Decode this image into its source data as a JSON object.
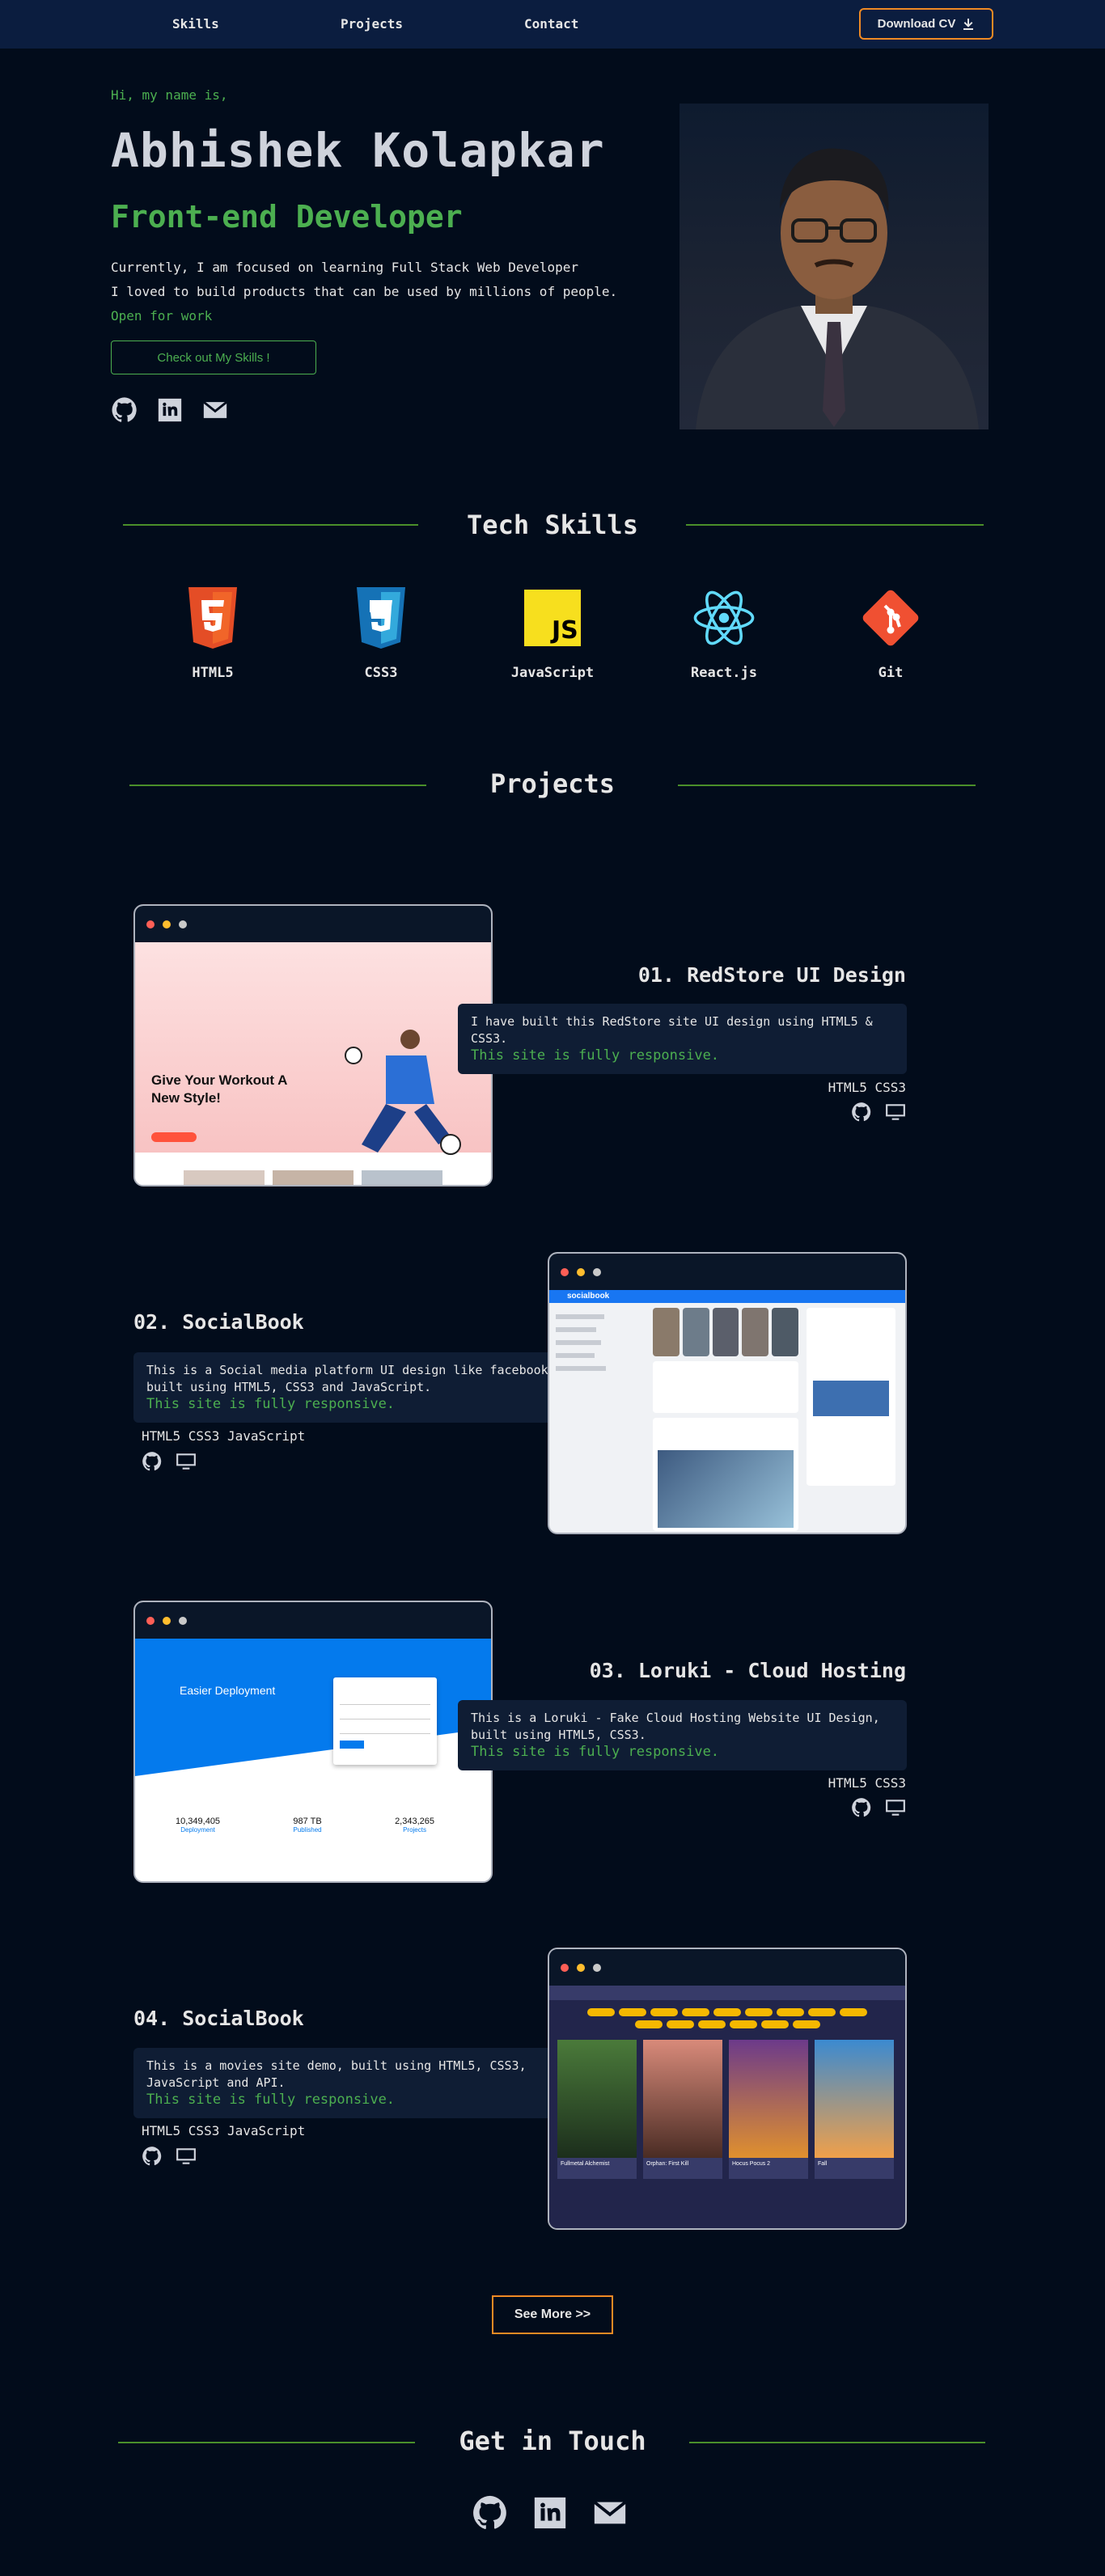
{
  "nav": {
    "items": [
      "Skills",
      "Projects",
      "Contact"
    ],
    "download_cv": "Download CV"
  },
  "hero": {
    "greeting": "Hi, my name is,",
    "name": "Abhishek Kolapkar",
    "role": "Front-end Developer",
    "bio_line1": "Currently, I am focused on learning Full Stack Web Developer",
    "bio_line2": "I loved to build products that can be used by millions of people.",
    "status": "Open for work",
    "cta": "Check out My Skills !"
  },
  "skills": {
    "title": "Tech Skills",
    "items": [
      {
        "label": "HTML5",
        "color": "#e44d26"
      },
      {
        "label": "CSS3",
        "color": "#1572b6"
      },
      {
        "label": "JavaScript",
        "color": "#f7df1e"
      },
      {
        "label": "React.js",
        "color": "#61dafb"
      },
      {
        "label": "Git",
        "color": "#f05032"
      }
    ]
  },
  "projects": {
    "title": "Projects",
    "items": [
      {
        "title": "01. RedStore UI Design",
        "desc": "I have built this RedStore site UI design using HTML5 & CSS3.",
        "note": "This site is fully responsive.",
        "tags": "HTML5 CSS3",
        "preview_heading": "Give Your Workout A New Style!"
      },
      {
        "title": "02. SocialBook",
        "desc": "This is a Social media platform UI design like facebook, built using HTML5, CSS3 and JavaScript.",
        "note": "This site is fully responsive.",
        "tags": "HTML5 CSS3 JavaScript",
        "preview_brand": "socialbook"
      },
      {
        "title": "03. Loruki - Cloud Hosting",
        "desc": "This is a Loruki - Fake Cloud Hosting Website UI Design, built using HTML5, CSS3.",
        "note": "This site is fully responsive.",
        "tags": "HTML5 CSS3",
        "preview_heading": "Easier Deployment",
        "preview_stats": [
          "10,349,405",
          "987 TB",
          "2,343,265"
        ],
        "preview_stat_labels": [
          "Deployment",
          "Published",
          "Projects"
        ]
      },
      {
        "title": "04. SocialBook",
        "desc": "This is a movies site demo, built using HTML5, CSS3, JavaScript and API.",
        "note": "This site is fully responsive.",
        "tags": "HTML5 CSS3 JavaScript",
        "preview_movies": [
          "Fullmetal Alchemist",
          "Orphan: First Kill",
          "Hocus Pocus 2",
          "Fall"
        ]
      }
    ],
    "see_more": "See More >>"
  },
  "contact": {
    "title": "Get in Touch"
  },
  "colors": {
    "background": "#020c1b",
    "nav": "#0b1d3f",
    "accent_green": "#4caf50",
    "accent_orange": "#f08a24"
  }
}
